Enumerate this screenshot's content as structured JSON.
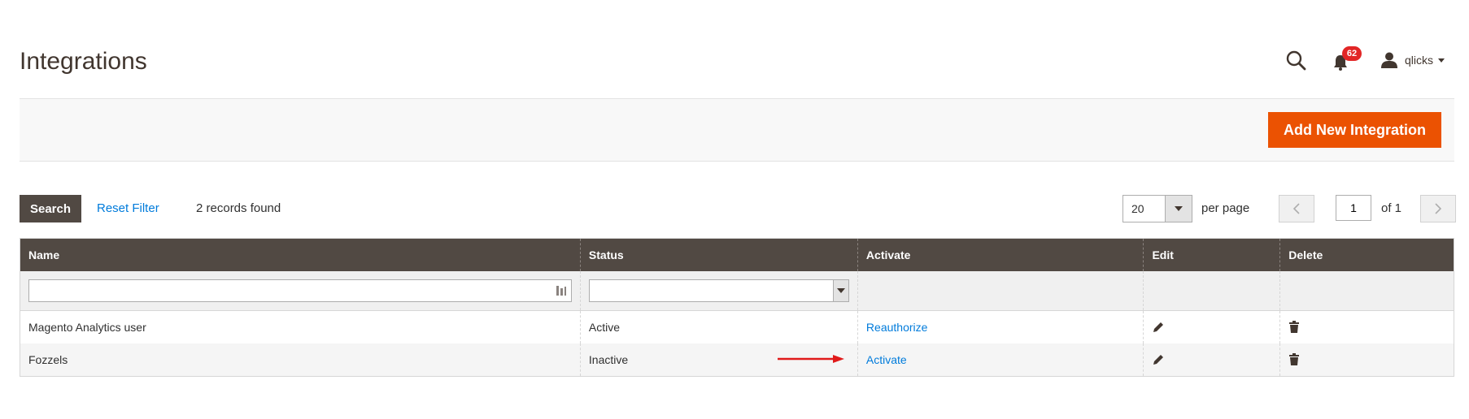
{
  "header": {
    "title": "Integrations",
    "notifications_count": "62",
    "user_name": "qlicks"
  },
  "action_bar": {
    "add_button_label": "Add New Integration"
  },
  "controls": {
    "search_label": "Search",
    "reset_filter_label": "Reset Filter",
    "records_found": "2 records found",
    "per_page_value": "20",
    "per_page_label": "per page",
    "current_page": "1",
    "page_of": "of 1"
  },
  "table": {
    "columns": [
      "Name",
      "Status",
      "Activate",
      "Edit",
      "Delete"
    ],
    "rows": [
      {
        "name": "Magento Analytics user",
        "status": "Active",
        "activate": "Reauthorize"
      },
      {
        "name": "Fozzels",
        "status": "Inactive",
        "activate": "Activate"
      }
    ]
  },
  "colors": {
    "accent": "#eb5202",
    "header_bg": "#514943",
    "link": "#007bdb",
    "badge": "#e22626",
    "annotation": "#e01a1a"
  },
  "icons": [
    "search-icon",
    "bell-icon",
    "user-icon",
    "filter-icon",
    "pencil-icon",
    "trash-icon"
  ]
}
